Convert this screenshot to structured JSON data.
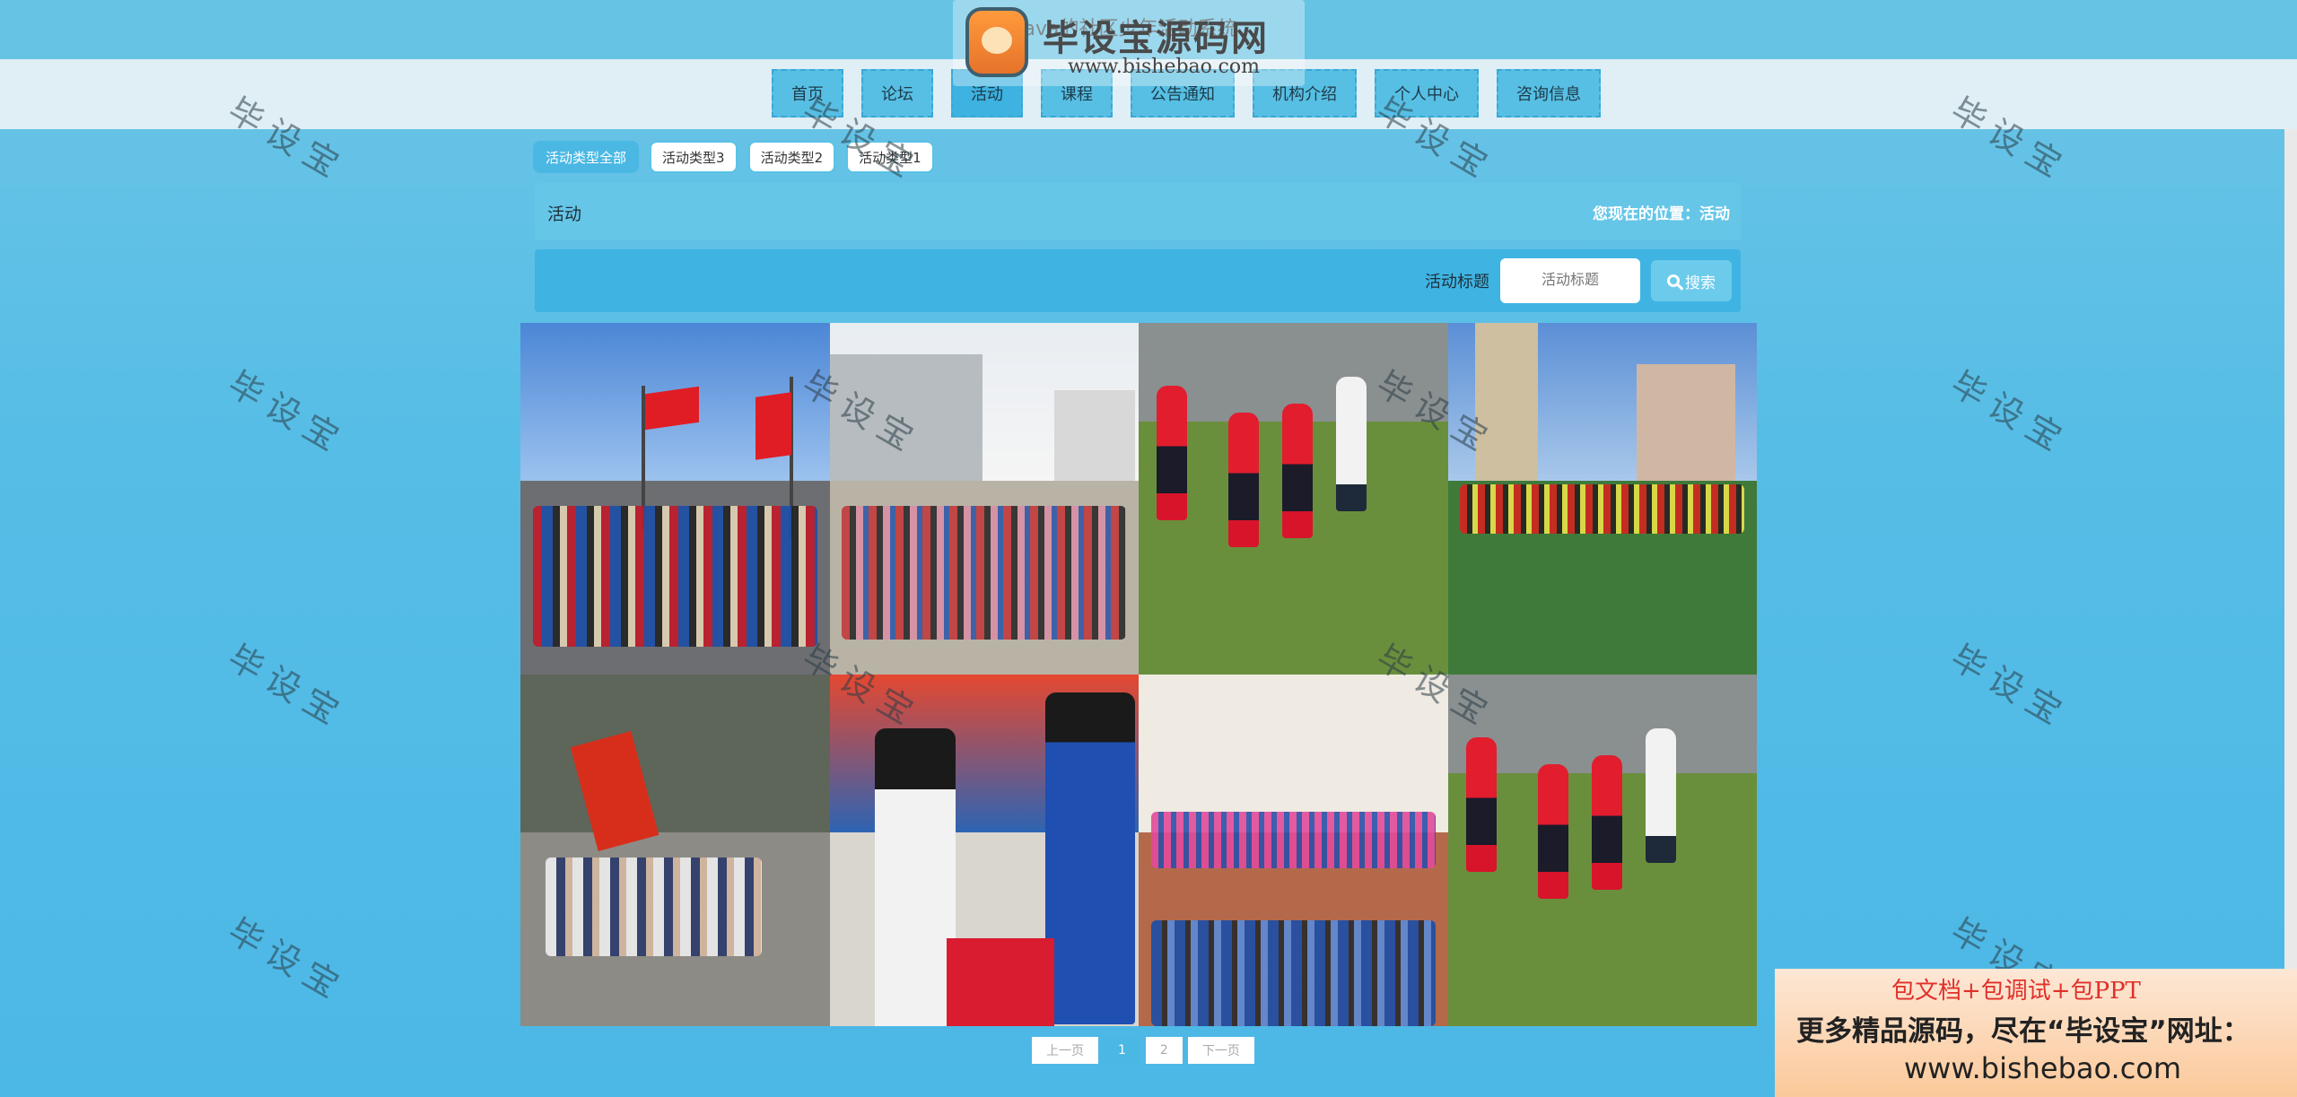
{
  "header": {
    "site_title": "基于Java的社区少年活动系统",
    "logo_main": "毕设宝源码网",
    "logo_url": "www.bishebao.com"
  },
  "nav": {
    "items": [
      "首页",
      "论坛",
      "活动",
      "课程",
      "公告通知",
      "机构介绍",
      "个人中心",
      "咨询信息"
    ],
    "active": "活动"
  },
  "filters": {
    "pills": [
      "活动类型全部",
      "活动类型3",
      "活动类型2",
      "活动类型1"
    ],
    "active": "活动类型全部"
  },
  "breadcrumb": {
    "title": "活动",
    "location": "您现在的位置：活动"
  },
  "search": {
    "label": "活动标题",
    "placeholder": "活动标题",
    "button": "搜索"
  },
  "pagination": [
    "上一页",
    "1",
    "2",
    "下一页"
  ],
  "watermark": "毕设宝",
  "ad": {
    "line1": "包文档+包调试+包PPT",
    "line2": "更多精品源码，尽在“毕设宝”网址：",
    "line3": "www.bishebao.com"
  },
  "colors": {
    "accent": "#4ab8e3",
    "nav_bg": "#dfeff5"
  }
}
